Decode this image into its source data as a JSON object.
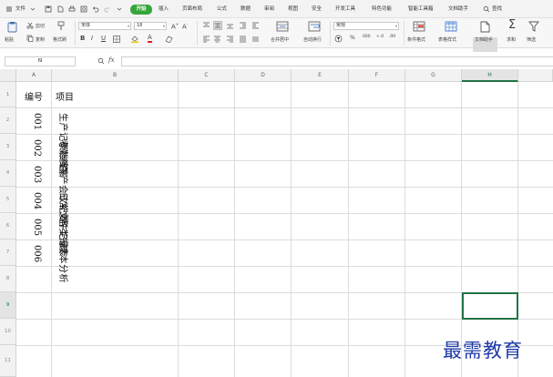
{
  "menubar": {
    "file": "文件",
    "tabs": [
      "开始",
      "插入",
      "页面布局",
      "公式",
      "数据",
      "审阅",
      "视图",
      "安全",
      "开发工具",
      "特色功能",
      "智能工具箱",
      "文档助手"
    ],
    "search": "查找"
  },
  "ribbon": {
    "paste": "粘贴",
    "cut": "剪切",
    "copy": "复制",
    "format_painter": "格式刷",
    "font_name": "宋体",
    "font_size": "18",
    "merge_center": "合并居中",
    "wrap_text": "自动换行",
    "number_format": "常规",
    "percent": "%",
    "thousands": "000",
    "inc_decimal": "+.0",
    "dec_decimal": ".00",
    "conditional_format": "条件格式",
    "table_style": "表格样式",
    "doc_helper": "文档助手",
    "sum": "求和",
    "filter": "筛选"
  },
  "formula_bar": {
    "cell_ref": "I9",
    "fx": "fx",
    "content": ""
  },
  "sheet": {
    "columns": [
      "A",
      "B",
      "C",
      "D",
      "E",
      "F",
      "G",
      "H"
    ],
    "rows": [
      "1",
      "2",
      "3",
      "4",
      "5",
      "6",
      "7",
      "8",
      "9",
      "10",
      "11"
    ],
    "header": {
      "a": "编号",
      "b": "项目"
    },
    "records": [
      {
        "no": "001",
        "item": "生产记录档案"
      },
      {
        "no": "002",
        "item": "考勤档案"
      },
      {
        "no": "003",
        "item": "生产会议纪要"
      },
      {
        "no": "004",
        "item": "日常文件记录"
      },
      {
        "no": "005",
        "item": "各类报表"
      },
      {
        "no": "006",
        "item": "成本分析"
      }
    ]
  },
  "watermark": "最需教育",
  "colors": {
    "accent": "#217346",
    "tab_active": "#36a63a",
    "watermark": "#1e3aa8"
  }
}
